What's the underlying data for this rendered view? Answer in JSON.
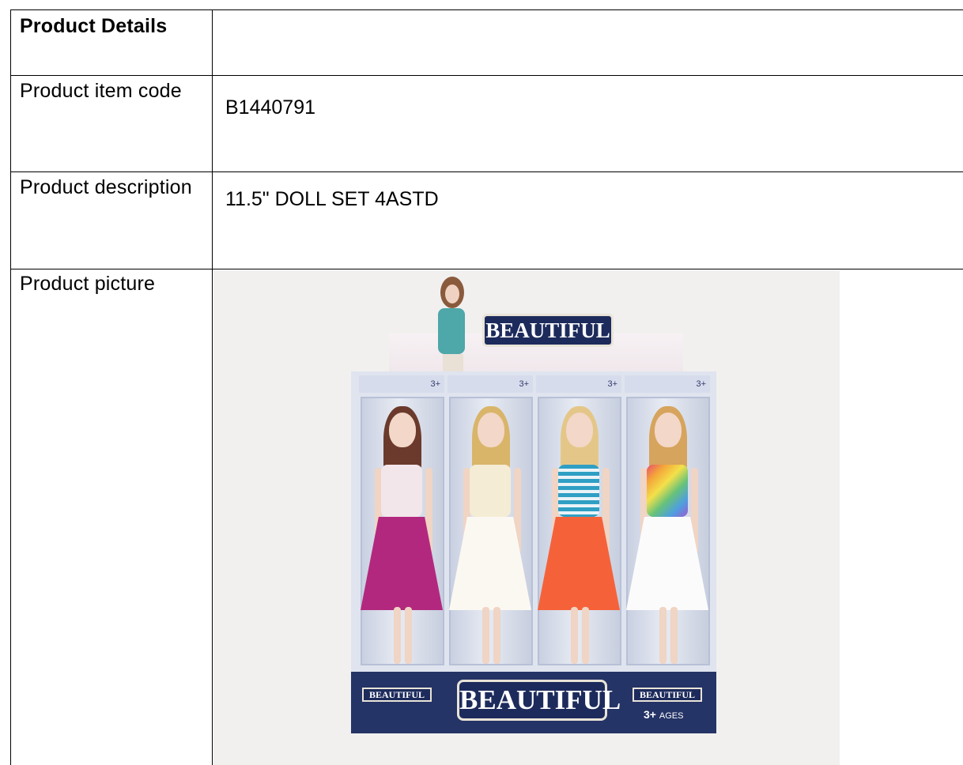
{
  "table": {
    "rows": [
      {
        "label": "Product Details",
        "value": ""
      },
      {
        "label": "Product item code",
        "value": "B1440791"
      },
      {
        "label": "Product description",
        "value": "11.5\" DOLL SET 4ASTD"
      },
      {
        "label": "Product picture",
        "value": ""
      }
    ]
  },
  "picture": {
    "brand_big": "BEAUTIFUL",
    "brand_small": "BEAUTIFUL",
    "brand_top": "BEAUTIFUL",
    "age_badge": "3+",
    "ages_number": "3+",
    "ages_word": "AGES"
  }
}
